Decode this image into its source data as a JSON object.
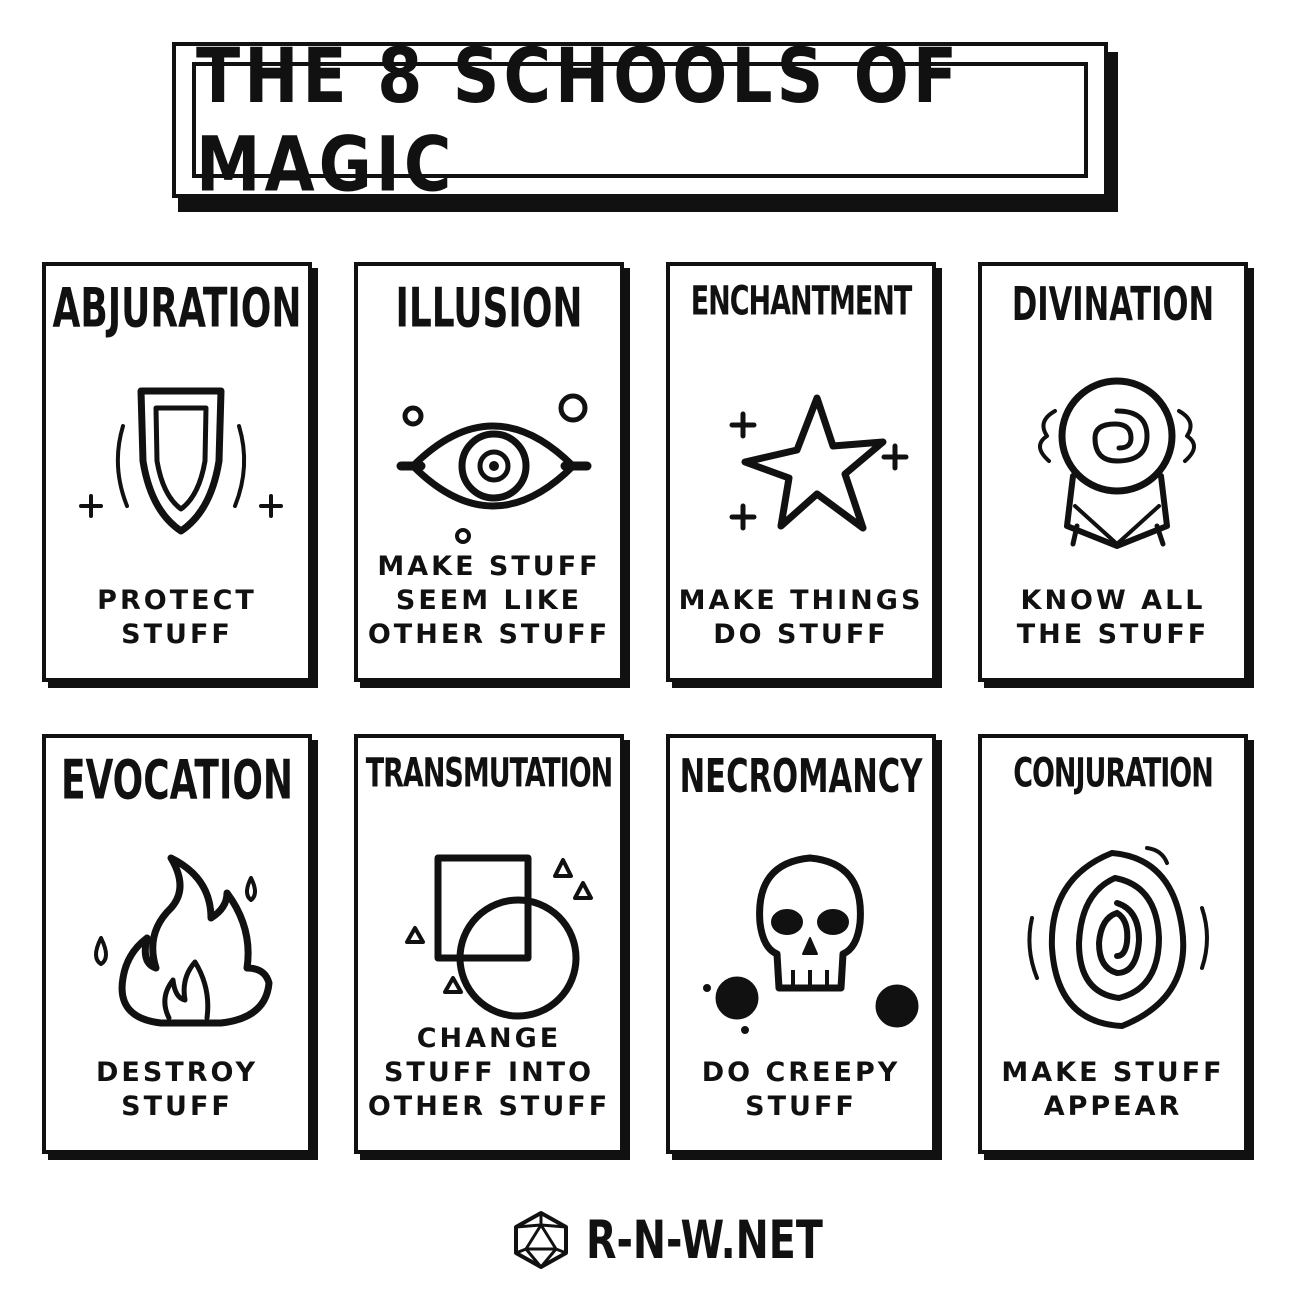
{
  "title": "THE 8 SCHOOLS OF MAGIC",
  "schools": [
    {
      "name": "ABJURATION",
      "description": "PROTECT\nSTUFF",
      "icon": "shield-icon"
    },
    {
      "name": "ILLUSION",
      "description": "MAKE STUFF\nSEEM LIKE\nOTHER STUFF",
      "icon": "eye-icon"
    },
    {
      "name": "ENCHANTMENT",
      "description": "MAKE THINGS\nDO STUFF",
      "icon": "star-icon"
    },
    {
      "name": "DIVINATION",
      "description": "KNOW ALL\nTHE STUFF",
      "icon": "crystal-ball-icon"
    },
    {
      "name": "EVOCATION",
      "description": "DESTROY\nSTUFF",
      "icon": "fire-icon"
    },
    {
      "name": "TRANSMUTATION",
      "description": "CHANGE\nSTUFF INTO\nOTHER STUFF",
      "icon": "shapes-icon"
    },
    {
      "name": "NECROMANCY",
      "description": "DO CREEPY\nSTUFF",
      "icon": "skull-icon"
    },
    {
      "name": "CONJURATION",
      "description": "MAKE STUFF\nAPPEAR",
      "icon": "portal-icon"
    }
  ],
  "footer": {
    "site": "R-N-W.NET",
    "icon": "d20-die-icon"
  }
}
